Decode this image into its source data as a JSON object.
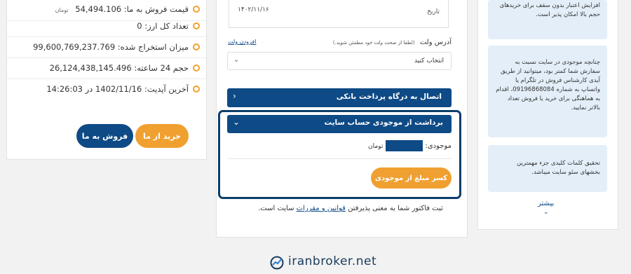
{
  "stats": {
    "sell_price_label": "قیمت فروش به ما:",
    "sell_price_value": "54,494.106",
    "sell_price_unit": "تومان",
    "total_units": "تعداد کل ارز: 0",
    "extracted": "میزان استخراج شده: 99,600,769,237.769",
    "volume_24h": "حجم 24 ساعته: 26,124,438,145.496",
    "last_update": "آخرین آپدیت: 1402/11/16 در 14:26:03"
  },
  "actions": {
    "buy_label": "خرید از ما",
    "sell_label": "فروش به ما"
  },
  "form": {
    "date_label": "تاریخ",
    "date_value": "۱۴۰۲/۱۱/۱۶",
    "wallet_label": "آدرس ولت",
    "wallet_note": "(لطفا از صحت ولت خود مطمئن شوید.)",
    "add_wallet": "افزودن ولت",
    "select_placeholder": "انتخاب کنید",
    "bank_gateway": "اتصال به درگاه پرداخت بانکی",
    "wallet_balance_title": "برداشت از موجودی حساب سایت",
    "balance_label": "موجودی:",
    "balance_unit": "تومان",
    "deduct_button": "کسر مبلغ از موجودی",
    "terms_prefix": "ثبت فاکتور شما به معنی پذیرفتن",
    "terms_link": "قوانین و مقررات",
    "terms_suffix": "سایت است."
  },
  "tips": {
    "tip1": "افزایش اعتبار بدون سقف برای خریدهای حجم بالا امکان پذیر است.",
    "tip2": "چنانچه موجودی در سایت نسبت به سفارش شما کمتر بود، میتوانید از طریق آیدی کارشناس فروش در تلگرام یا واتساپ به شماره 09196868084، اقدام به هماهنگی برای خرید یا فروش تعداد بالاتر نمایید.",
    "tip3": "تحقیق کلمات کلیدی جزء مهمترین بخشهای سئو سایت میباشد.",
    "more": "بیشتر"
  },
  "watermark": "iranbroker.net",
  "colors": {
    "primary": "#0e4a85",
    "accent": "#f0a030"
  }
}
